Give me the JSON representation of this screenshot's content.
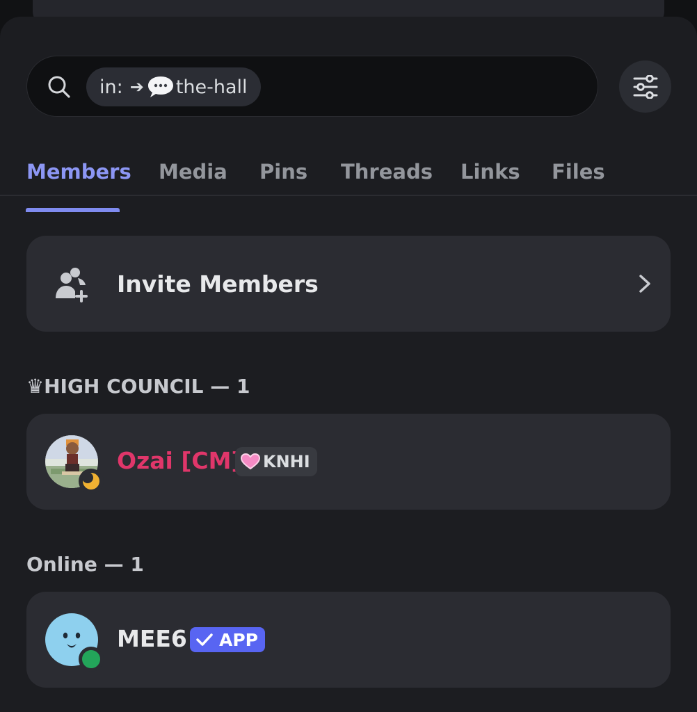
{
  "search": {
    "scope_prefix": "in:",
    "scope_arrow": "➔",
    "channel_name": "the-hall",
    "icon": "search-icon"
  },
  "filter_button": {
    "icon": "sliders-icon"
  },
  "tabs": [
    {
      "label": "Members",
      "active": true
    },
    {
      "label": "Media",
      "active": false
    },
    {
      "label": "Pins",
      "active": false
    },
    {
      "label": "Threads",
      "active": false
    },
    {
      "label": "Links",
      "active": false
    },
    {
      "label": "Files",
      "active": false
    }
  ],
  "invite": {
    "label": "Invite Members",
    "icon": "add-member-icon",
    "chevron_icon": "chevron-right-icon"
  },
  "sections": [
    {
      "header": "♛HIGH COUNCIL — 1",
      "members": [
        {
          "name": "Ozai [CM]",
          "name_color": "#e0366a",
          "role_tag": "KNHI",
          "role_icon": "pink-heart-icon",
          "status": "idle",
          "status_color": "#f0b132"
        }
      ]
    },
    {
      "header": "Online — 1",
      "members": [
        {
          "name": "MEE6",
          "name_color": "#e8e9eb",
          "badge": "APP",
          "badge_icon": "checkmark-icon",
          "badge_color": "#5865f2",
          "status": "online",
          "status_color": "#23a55a"
        }
      ]
    }
  ],
  "colors": {
    "accent": "#8c96f4",
    "background": "#1c1d21",
    "card": "#2b2c32"
  }
}
